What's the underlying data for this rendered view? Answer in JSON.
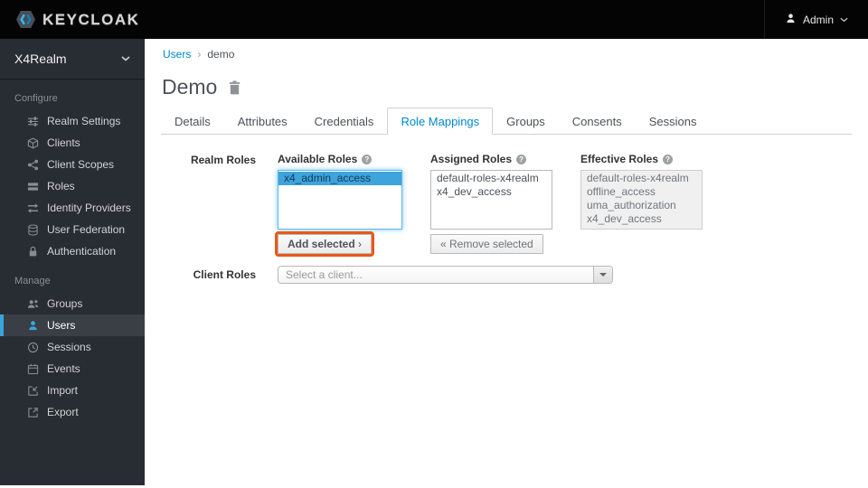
{
  "topbar": {
    "brand": "KEYCLOAK",
    "user": {
      "label": "Admin",
      "icon": "user-icon",
      "chevron_icon": "chevron-down-icon"
    }
  },
  "sidebar": {
    "realm_selector": {
      "label": "X4Realm",
      "chevron_icon": "chevron-down-icon"
    },
    "sections": [
      {
        "header": "Configure",
        "items": [
          {
            "label": "Realm Settings",
            "icon": "sliders-icon"
          },
          {
            "label": "Clients",
            "icon": "cube-icon"
          },
          {
            "label": "Client Scopes",
            "icon": "share-nodes-icon"
          },
          {
            "label": "Roles",
            "icon": "list-icon"
          },
          {
            "label": "Identity Providers",
            "icon": "exchange-icon"
          },
          {
            "label": "User Federation",
            "icon": "database-icon"
          },
          {
            "label": "Authentication",
            "icon": "lock-icon"
          }
        ]
      },
      {
        "header": "Manage",
        "items": [
          {
            "label": "Groups",
            "icon": "groups-icon"
          },
          {
            "label": "Users",
            "icon": "user-icon",
            "active": true
          },
          {
            "label": "Sessions",
            "icon": "clock-icon"
          },
          {
            "label": "Events",
            "icon": "calendar-icon"
          },
          {
            "label": "Import",
            "icon": "import-icon"
          },
          {
            "label": "Export",
            "icon": "export-icon"
          }
        ]
      }
    ]
  },
  "breadcrumb": {
    "items": [
      "Users",
      "demo"
    ],
    "separator": "›"
  },
  "page": {
    "title": "Demo",
    "delete_icon": "trash-icon"
  },
  "tabs": {
    "active": "Role Mappings",
    "items": [
      {
        "label": "Details"
      },
      {
        "label": "Attributes"
      },
      {
        "label": "Credentials"
      },
      {
        "label": "Role Mappings"
      },
      {
        "label": "Groups"
      },
      {
        "label": "Consents"
      },
      {
        "label": "Sessions"
      }
    ]
  },
  "role_mappings": {
    "realm_roles_label": "Realm Roles",
    "client_roles_label": "Client Roles",
    "available_roles": {
      "label": "Available Roles",
      "help_icon": "question-circle-icon",
      "items": [
        "x4_admin_access"
      ],
      "selected": "x4_admin_access"
    },
    "assigned_roles": {
      "label": "Assigned Roles",
      "help_icon": "question-circle-icon",
      "items": [
        "default-roles-x4realm",
        "x4_dev_access"
      ]
    },
    "effective_roles": {
      "label": "Effective Roles",
      "help_icon": "question-circle-icon",
      "items": [
        "default-roles-x4realm",
        "offline_access",
        "uma_authorization",
        "x4_dev_access"
      ]
    },
    "add_selected_button": "Add selected",
    "add_selected_chevron": "›",
    "remove_selected_button": "« Remove selected",
    "client_select": {
      "placeholder": "Select a client...",
      "chevron_icon": "caret-down-icon"
    }
  },
  "colors": {
    "accent": "#0088ce",
    "topbar_bg": "#040404",
    "sidebar_bg": "#282c33",
    "sidebar_active_accent": "#39a5dc",
    "selection_bg": "#3fa3dc",
    "annotation_highlight": "#e8591a"
  }
}
